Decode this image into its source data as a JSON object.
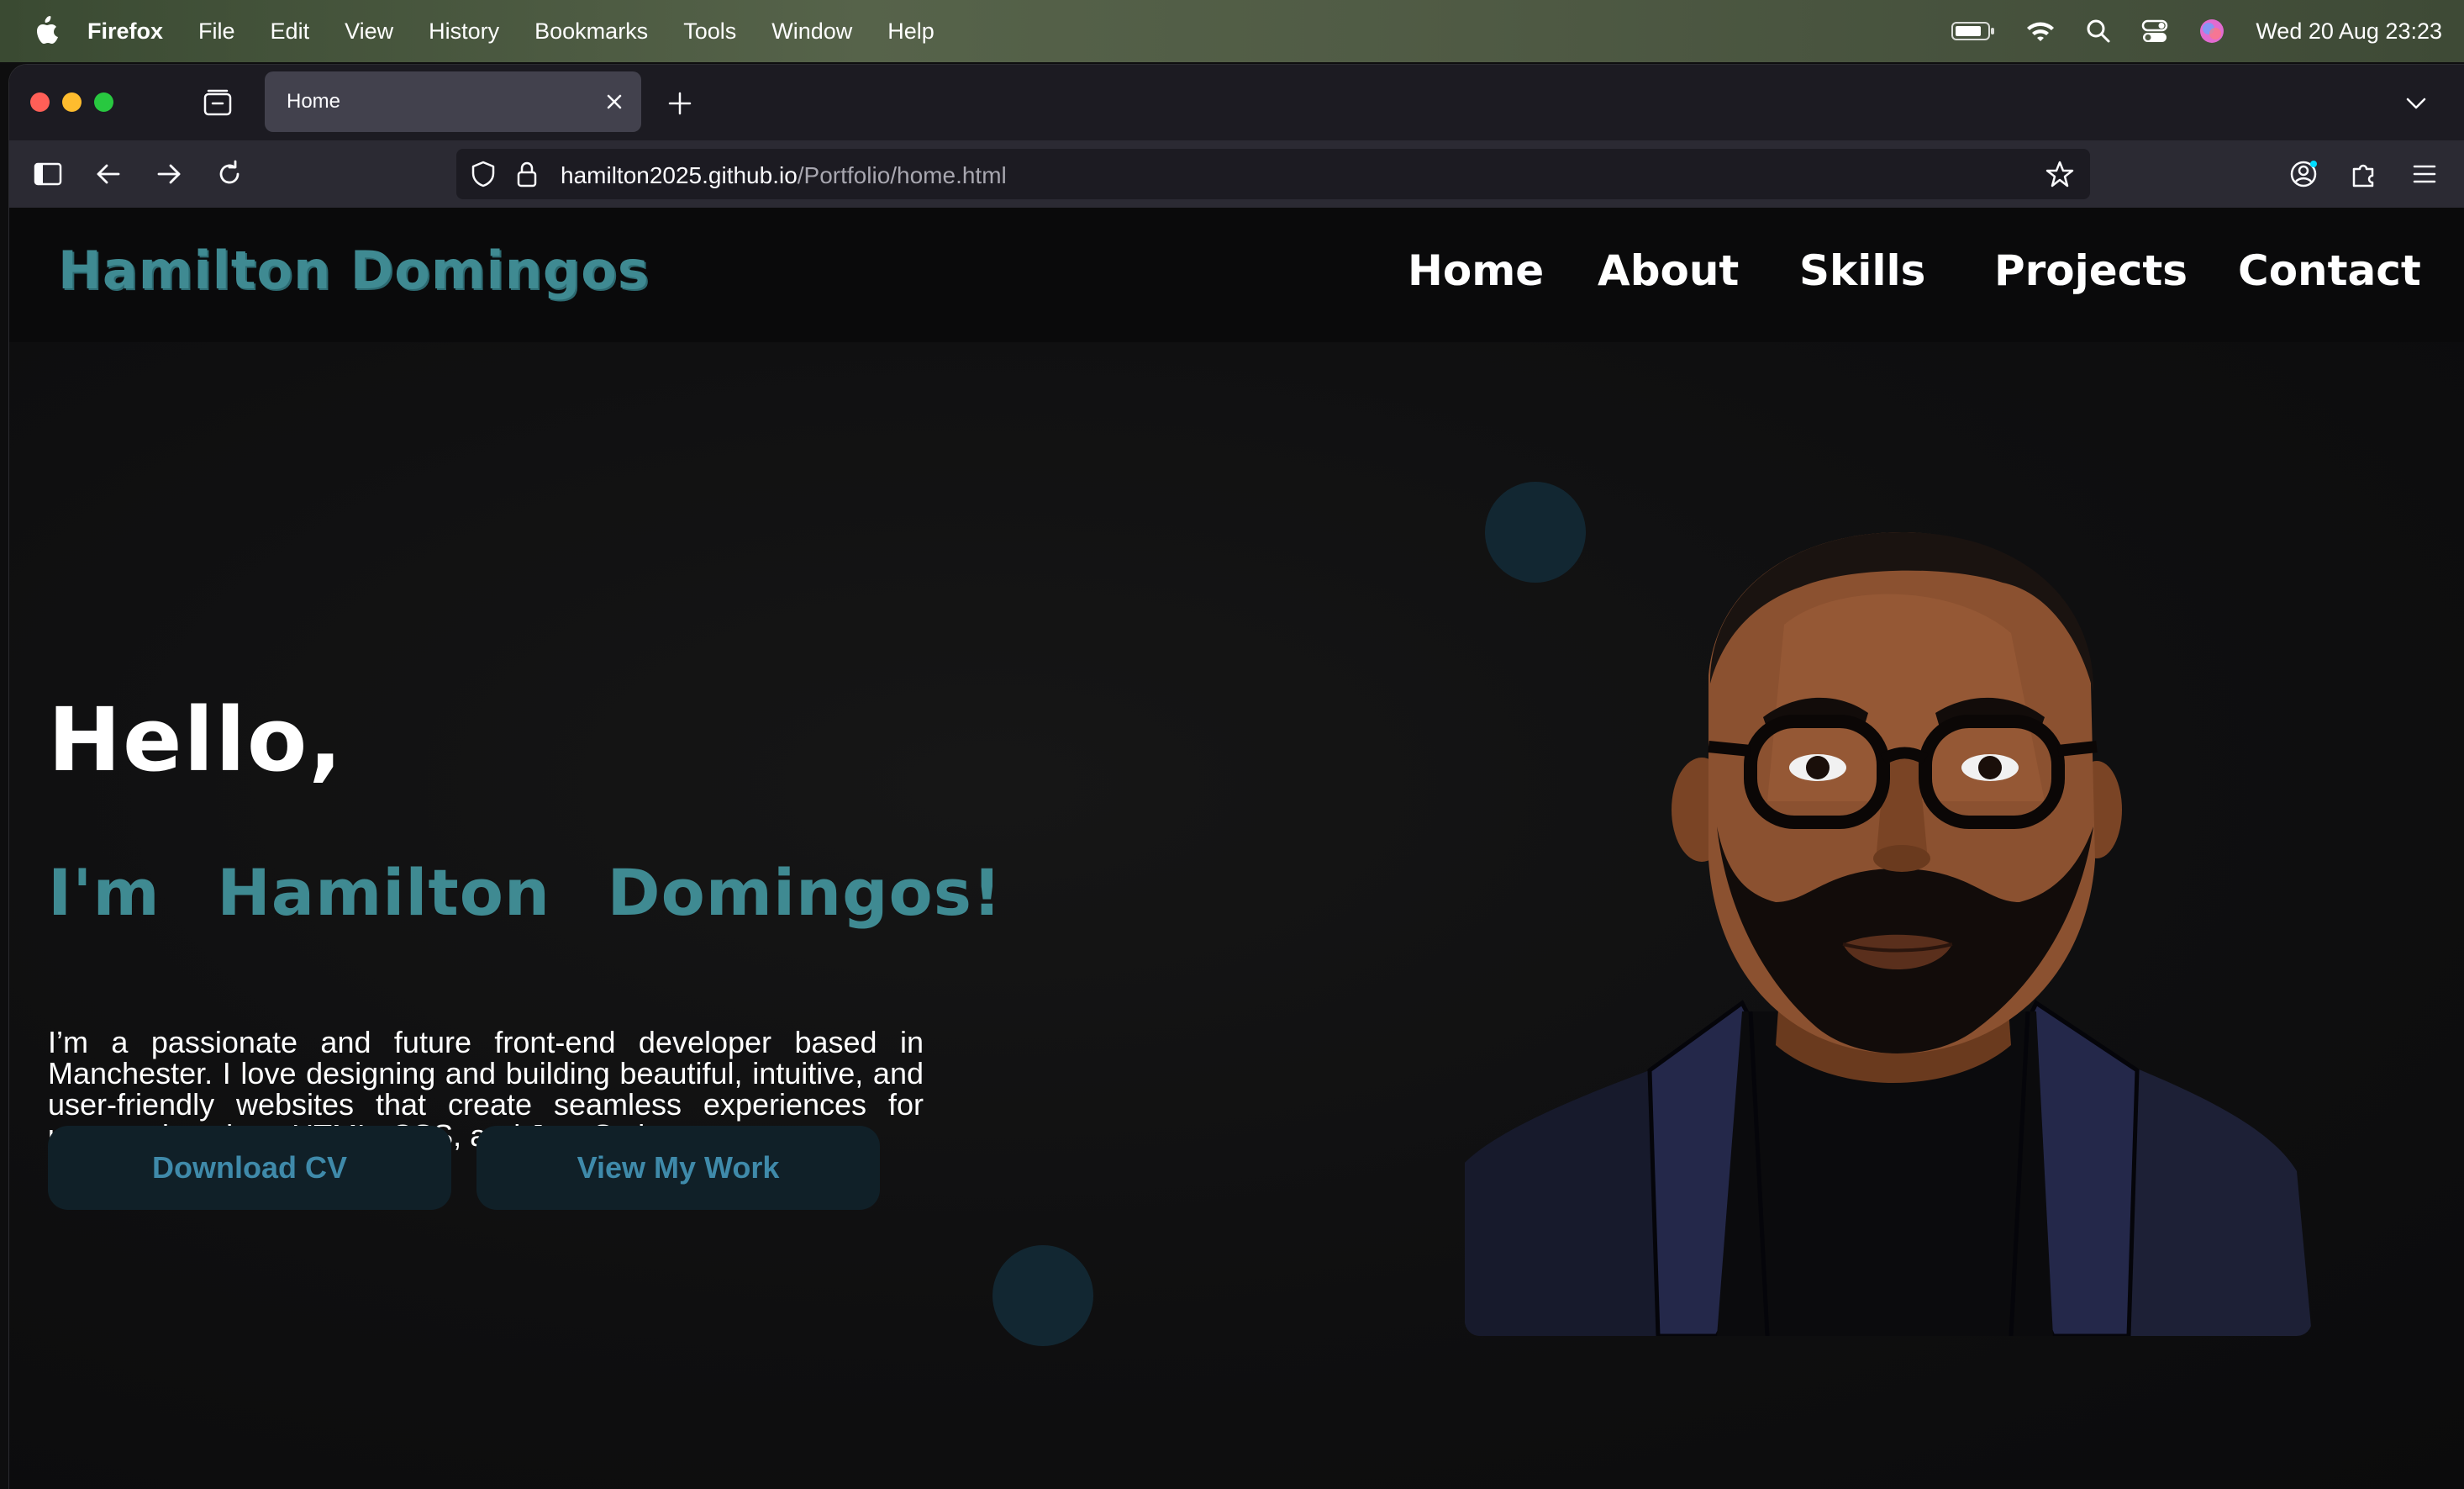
{
  "menubar": {
    "app_name": "Firefox",
    "items": [
      "File",
      "Edit",
      "View",
      "History",
      "Bookmarks",
      "Tools",
      "Window",
      "Help"
    ],
    "clock": "Wed 20 Aug  23:23"
  },
  "browser": {
    "tab_title": "Home",
    "url_host": "hamilton2025.github.io",
    "url_path": "/Portfolio/home.html"
  },
  "site": {
    "logo": "Hamilton Domingos",
    "nav": [
      "Home",
      "About",
      "Skills",
      "Projects",
      "Contact"
    ],
    "hello": "Hello,",
    "subtitle": "I'm Hamilton Domingos!",
    "intro": "I’m a passionate and future front-end developer based in Manchester. I love designing and building beautiful, intuitive, and user-friendly websites that create seamless experiences for users using clean HTML, CSS, and JavaScript.",
    "download_cv": "Download CV",
    "view_work": "View My Work"
  },
  "colors": {
    "accent": "#3f8a92",
    "button_bg": "#102028",
    "button_text": "#3f8aaa",
    "page_bg": "#0e0e0f"
  }
}
